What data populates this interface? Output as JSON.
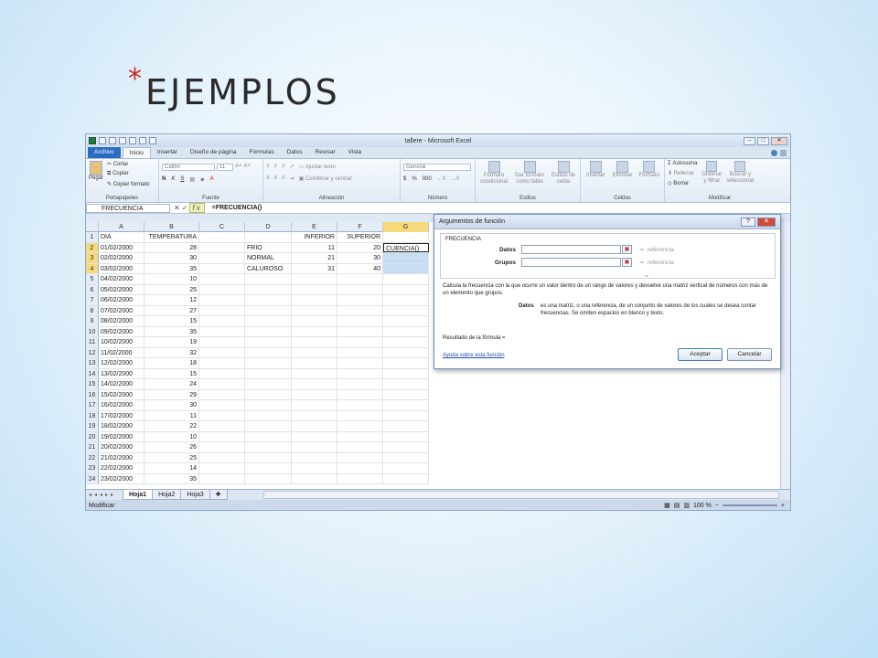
{
  "slide": {
    "bullet": "*",
    "heading": "EJEMPLOS"
  },
  "window": {
    "title": "tallere - Microsoft Excel"
  },
  "ribbon": {
    "tabs": [
      "Archivo",
      "Inicio",
      "Insertar",
      "Diseño de página",
      "Fórmulas",
      "Datos",
      "Revisar",
      "Vista"
    ],
    "active_tab": "Inicio",
    "groups": {
      "clipboard": {
        "label": "Portapapeles",
        "paste": "Pegar",
        "cut": "Cortar",
        "copy": "Copiar",
        "format_painter": "Copiar formato"
      },
      "font": {
        "label": "Fuente",
        "font_name": "Calibri",
        "font_size": "11",
        "bold": "N",
        "italic": "K",
        "underline": "S"
      },
      "alignment": {
        "label": "Alineación",
        "wrap": "Ajustar texto",
        "merge": "Combinar y centrar"
      },
      "number": {
        "label": "Número",
        "format": "General",
        "currency": "$",
        "percent": "%",
        "thousands": "000"
      },
      "styles": {
        "label": "Estilos",
        "conditional": "Formato condicional",
        "table": "Dar formato como tabla",
        "cell_styles": "Estilos de celda"
      },
      "cells": {
        "label": "Celdas",
        "insert": "Insertar",
        "delete": "Eliminar",
        "format": "Formato"
      },
      "editing": {
        "label": "Modificar",
        "autosum": "Autosuma",
        "fill": "Rellenar",
        "clear": "Borrar",
        "sort": "Ordenar y filtrar",
        "find": "Buscar y seleccionar"
      }
    }
  },
  "formula_bar": {
    "name_box": "FRECUENCIA",
    "formula": "=FRECUENCIA()"
  },
  "columns": [
    "A",
    "B",
    "C",
    "D",
    "E",
    "F",
    "G"
  ],
  "rows": [
    {
      "n": "1",
      "a": "DIA",
      "b": "TEMPERATURA",
      "c": "",
      "d": "",
      "e": "INFERIOR",
      "f": "SUPERIOR",
      "g": ""
    },
    {
      "n": "2",
      "a": "01/02/2000",
      "b": "28",
      "c": "",
      "d": "FRIO",
      "e": "11",
      "f": "20",
      "g": "CUENCIA()"
    },
    {
      "n": "3",
      "a": "02/02/2000",
      "b": "30",
      "c": "",
      "d": "NORMAL",
      "e": "21",
      "f": "30",
      "g": ""
    },
    {
      "n": "4",
      "a": "03/02/2000",
      "b": "35",
      "c": "",
      "d": "CALUROSO",
      "e": "31",
      "f": "40",
      "g": ""
    },
    {
      "n": "5",
      "a": "04/02/2000",
      "b": "10",
      "c": "",
      "d": "",
      "e": "",
      "f": "",
      "g": ""
    },
    {
      "n": "6",
      "a": "05/02/2000",
      "b": "25",
      "c": "",
      "d": "",
      "e": "",
      "f": "",
      "g": ""
    },
    {
      "n": "7",
      "a": "06/02/2000",
      "b": "12",
      "c": "",
      "d": "",
      "e": "",
      "f": "",
      "g": ""
    },
    {
      "n": "8",
      "a": "07/02/2000",
      "b": "27",
      "c": "",
      "d": "",
      "e": "",
      "f": "",
      "g": ""
    },
    {
      "n": "9",
      "a": "08/02/2000",
      "b": "15",
      "c": "",
      "d": "",
      "e": "",
      "f": "",
      "g": ""
    },
    {
      "n": "10",
      "a": "09/02/2000",
      "b": "35",
      "c": "",
      "d": "",
      "e": "",
      "f": "",
      "g": ""
    },
    {
      "n": "11",
      "a": "10/02/2000",
      "b": "19",
      "c": "",
      "d": "",
      "e": "",
      "f": "",
      "g": ""
    },
    {
      "n": "12",
      "a": "11/02/2000",
      "b": "32",
      "c": "",
      "d": "",
      "e": "",
      "f": "",
      "g": ""
    },
    {
      "n": "13",
      "a": "12/02/2000",
      "b": "18",
      "c": "",
      "d": "",
      "e": "",
      "f": "",
      "g": ""
    },
    {
      "n": "14",
      "a": "13/02/2000",
      "b": "15",
      "c": "",
      "d": "",
      "e": "",
      "f": "",
      "g": ""
    },
    {
      "n": "15",
      "a": "14/02/2000",
      "b": "24",
      "c": "",
      "d": "",
      "e": "",
      "f": "",
      "g": ""
    },
    {
      "n": "16",
      "a": "15/02/2000",
      "b": "29",
      "c": "",
      "d": "",
      "e": "",
      "f": "",
      "g": ""
    },
    {
      "n": "17",
      "a": "16/02/2000",
      "b": "30",
      "c": "",
      "d": "",
      "e": "",
      "f": "",
      "g": ""
    },
    {
      "n": "18",
      "a": "17/02/2000",
      "b": "11",
      "c": "",
      "d": "",
      "e": "",
      "f": "",
      "g": ""
    },
    {
      "n": "19",
      "a": "18/02/2000",
      "b": "22",
      "c": "",
      "d": "",
      "e": "",
      "f": "",
      "g": ""
    },
    {
      "n": "20",
      "a": "19/02/2000",
      "b": "10",
      "c": "",
      "d": "",
      "e": "",
      "f": "",
      "g": ""
    },
    {
      "n": "21",
      "a": "20/02/2000",
      "b": "26",
      "c": "",
      "d": "",
      "e": "",
      "f": "",
      "g": ""
    },
    {
      "n": "22",
      "a": "21/02/2000",
      "b": "25",
      "c": "",
      "d": "",
      "e": "",
      "f": "",
      "g": ""
    },
    {
      "n": "23",
      "a": "22/02/2000",
      "b": "14",
      "c": "",
      "d": "",
      "e": "",
      "f": "",
      "g": ""
    },
    {
      "n": "24",
      "a": "23/02/2000",
      "b": "35",
      "c": "",
      "d": "",
      "e": "",
      "f": "",
      "g": ""
    }
  ],
  "sheet_tabs": [
    "Hoja1",
    "Hoja2",
    "Hoja3"
  ],
  "active_sheet": "Hoja1",
  "status": {
    "mode": "Modificar",
    "zoom": "100 %"
  },
  "dialog": {
    "title": "Argumentos de función",
    "function_name": "FRECUENCIA",
    "args": [
      {
        "label": "Datos",
        "value": "",
        "result": "referencia"
      },
      {
        "label": "Grupos",
        "value": "",
        "result": "referencia"
      }
    ],
    "eq": "=",
    "description": "Calcula la frecuencia con la que ocurre un valor dentro de un rango de valores y devuelve una matriz vertical de números con más de un elemento que grupos.",
    "arg_help_label": "Datos",
    "arg_help_text": "es una matriz, o una referencia, de un conjunto de valores de los cuales se desea contar frecuencias. Se omiten espacios en blanco y texto.",
    "result_label": "Resultado de la fórmula =",
    "help_link": "Ayuda sobre esta función",
    "ok": "Aceptar",
    "cancel": "Cancelar"
  },
  "colors": {
    "accent": "#2a6cc0",
    "selection": "#c8dcf2",
    "header_selected": "#f5d97b",
    "bullet": "#c8261e"
  }
}
